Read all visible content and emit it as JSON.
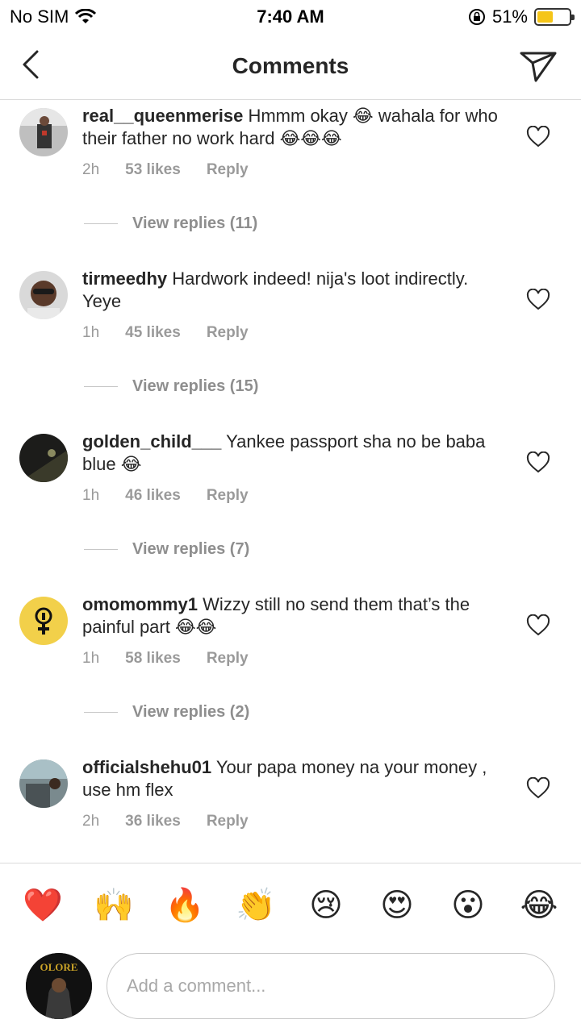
{
  "status": {
    "carrier": "No SIM",
    "time": "7:40 AM",
    "battery": "51%",
    "battery_level": 0.51
  },
  "header": {
    "title": "Comments"
  },
  "comments": [
    {
      "username": "real__queenmerise",
      "text": "Hmmm okay 😂 wahala for who their father no work hard 😂😂😂",
      "time": "2h",
      "likes": "53 likes",
      "reply": "Reply",
      "view_replies": "View replies (11)"
    },
    {
      "username": "tirmeedhy",
      "text": "Hardwork indeed! nija's loot indirectly. Yeye",
      "time": "1h",
      "likes": "45 likes",
      "reply": "Reply",
      "view_replies": "View replies (15)"
    },
    {
      "username": "golden_child___",
      "text": "Yankee passport sha no be baba blue 😂",
      "time": "1h",
      "likes": "46 likes",
      "reply": "Reply",
      "view_replies": "View replies (7)"
    },
    {
      "username": "omomommy1",
      "text": "Wizzy still no send them that’s the painful part 😂😂",
      "time": "1h",
      "likes": "58 likes",
      "reply": "Reply",
      "view_replies": "View replies (2)"
    },
    {
      "username": "officialshehu01",
      "text": "Your papa money na your money , use hm flex",
      "time": "2h",
      "likes": "36 likes",
      "reply": "Reply"
    }
  ],
  "emoji_bar": [
    "❤️",
    "🙌",
    "🔥",
    "👏",
    "😢",
    "😍",
    "😮",
    "😂"
  ],
  "input": {
    "placeholder": "Add a comment..."
  },
  "my_avatar": {
    "text": "OLORE"
  },
  "colors": {
    "meta": "#9a9a9a",
    "border": "#dbdbdb",
    "battery": "#f5c518",
    "like": "#262626"
  }
}
